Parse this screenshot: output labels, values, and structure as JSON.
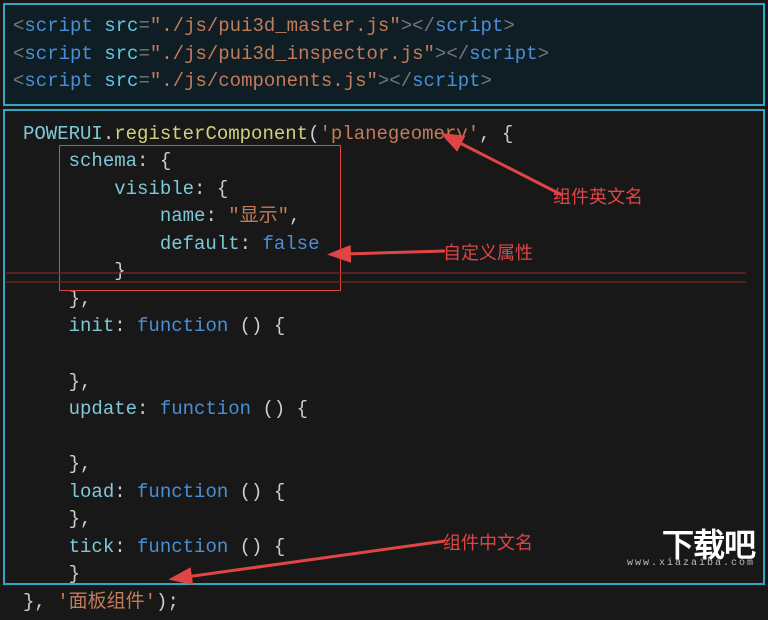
{
  "top": {
    "scripts": [
      "./js/pui3d_master.js",
      "./js/pui3d_inspector.js",
      "./js/components.js"
    ]
  },
  "code": {
    "register_ns": "POWERUI",
    "register_fn": "registerComponent",
    "component_en": "planegeomery",
    "schema_key": "schema",
    "schema_prop": "visible",
    "name_key": "name",
    "name_value": "显示",
    "default_key": "default",
    "default_value": "false",
    "init_key": "init",
    "update_key": "update",
    "load_key": "load",
    "tick_key": "tick",
    "function_kw": "function",
    "component_cn": "面板组件"
  },
  "annotations": {
    "en_name": "组件英文名",
    "custom_attr": "自定义属性",
    "cn_name": "组件中文名"
  },
  "logo": {
    "title": "下载吧",
    "url": "www.xiazaiba.com"
  }
}
